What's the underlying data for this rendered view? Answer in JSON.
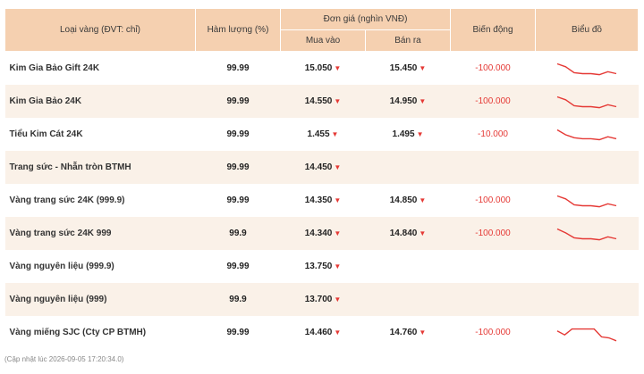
{
  "header": {
    "type_col": "Loại vàng (ĐVT: chỉ)",
    "purity_col": "Hàm lượng (%)",
    "price_group": "Đơn giá (nghìn VNĐ)",
    "buy_col": "Mua vào",
    "sell_col": "Bán ra",
    "change_col": "Biến động",
    "chart_col": "Biểu đồ"
  },
  "colors": {
    "header_bg": "#f5d0b0",
    "row_alt_bg": "#faf1e8",
    "down_red": "#e53935"
  },
  "icons": {
    "trend": "down-triangle-icon",
    "chart": "sparkline"
  },
  "rows": [
    {
      "name": "Kim Gia Bảo Gift 24K",
      "purity": "99.99",
      "buy": "15.050",
      "sell": "15.450",
      "change": "-100.000",
      "spark": [
        5,
        8,
        14,
        15,
        15,
        16,
        13,
        15
      ]
    },
    {
      "name": "Kim Gia Bảo 24K",
      "purity": "99.99",
      "buy": "14.550",
      "sell": "14.950",
      "change": "-100.000",
      "spark": [
        5,
        8,
        14,
        15,
        15,
        16,
        13,
        15
      ]
    },
    {
      "name": "Tiểu Kim Cát 24K",
      "purity": "99.99",
      "buy": "1.455",
      "sell": "1.495",
      "change": "-10.000",
      "spark": [
        5,
        10,
        13,
        14,
        14,
        15,
        12,
        14
      ]
    },
    {
      "name": "Trang sức - Nhẫn tròn BTMH",
      "purity": "99.99",
      "buy": "14.450",
      "sell": "",
      "change": "",
      "spark": []
    },
    {
      "name": "Vàng trang sức 24K (999.9)",
      "purity": "99.99",
      "buy": "14.350",
      "sell": "14.850",
      "change": "-100.000",
      "spark": [
        5,
        8,
        14,
        15,
        15,
        16,
        13,
        15
      ]
    },
    {
      "name": "Vàng trang sức 24K 999",
      "purity": "99.9",
      "buy": "14.340",
      "sell": "14.840",
      "change": "-100.000",
      "spark": [
        5,
        9,
        14,
        15,
        15,
        16,
        13,
        15
      ]
    },
    {
      "name": "Vàng nguyên liệu (999.9)",
      "purity": "99.99",
      "buy": "13.750",
      "sell": "",
      "change": "",
      "spark": []
    },
    {
      "name": "Vàng nguyên liệu (999)",
      "purity": "99.9",
      "buy": "13.700",
      "sell": "",
      "change": "",
      "spark": []
    },
    {
      "name": "Vàng miếng SJC (Cty CP BTMH)",
      "purity": "99.99",
      "buy": "14.460",
      "sell": "14.760",
      "change": "-100.000",
      "spark": [
        8,
        12,
        6,
        6,
        6,
        6,
        14,
        15,
        18
      ]
    }
  ],
  "footer": "(Cập nhật lúc 2026-09-05 17:20:34.0)"
}
